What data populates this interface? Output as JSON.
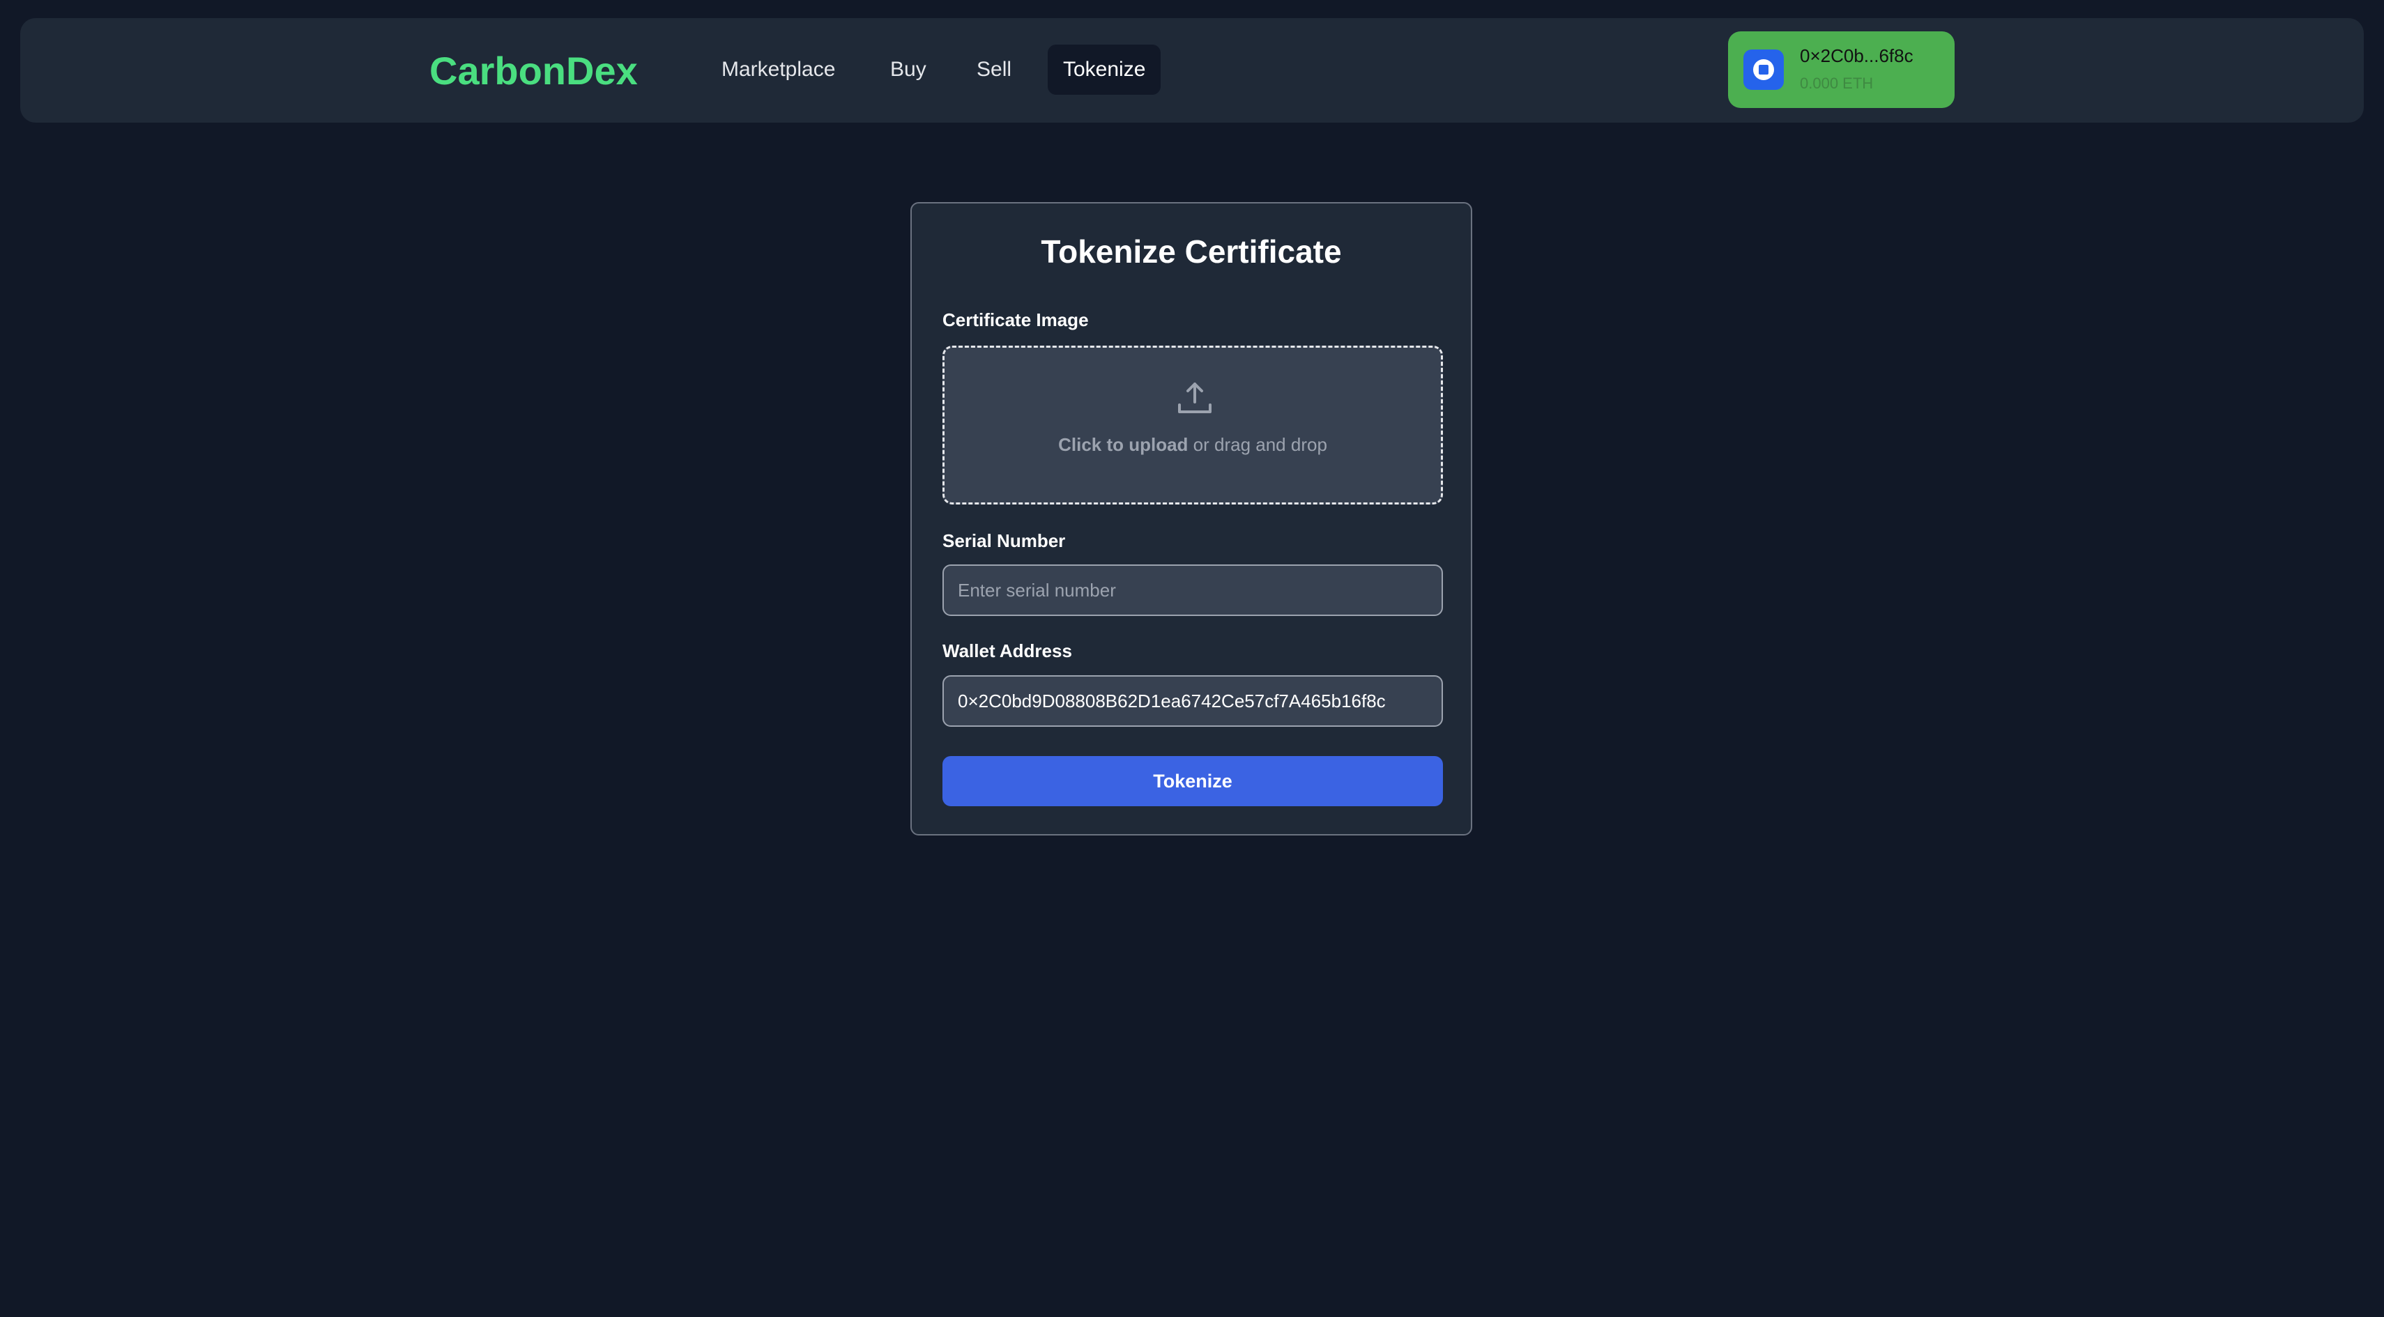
{
  "nav": {
    "brand": "CarbonDex",
    "links": [
      {
        "label": "Marketplace",
        "active": false
      },
      {
        "label": "Buy",
        "active": false
      },
      {
        "label": "Sell",
        "active": false
      },
      {
        "label": "Tokenize",
        "active": true
      }
    ],
    "wallet": {
      "address_short": "0×2C0b...6f8c",
      "balance": "0.000 ETH",
      "icon": "wallet-avatar-icon"
    }
  },
  "form": {
    "title": "Tokenize Certificate",
    "image_label": "Certificate Image",
    "upload_icon": "upload-icon",
    "upload_cta": "Click to upload",
    "upload_rest": " or drag and drop",
    "serial_label": "Serial Number",
    "serial_placeholder": "Enter serial number",
    "serial_value": "",
    "wallet_label": "Wallet Address",
    "wallet_value": "0×2C0bd9D08808B62D1ea6742Ce57cf7A465b16f8c",
    "submit_label": "Tokenize"
  },
  "colors": {
    "background": "#111827",
    "panel": "#1f2937",
    "brand": "#4ade80",
    "wallet_button": "#4caf50",
    "primary_button": "#3b63e3"
  }
}
